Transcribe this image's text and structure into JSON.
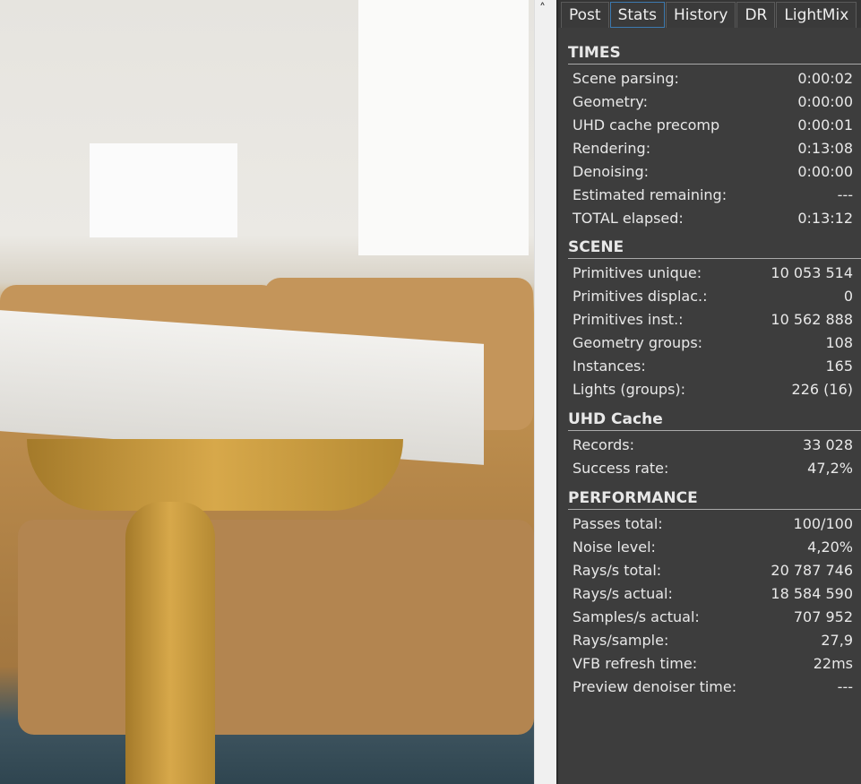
{
  "tabs": [
    "Post",
    "Stats",
    "History",
    "DR",
    "LightMix"
  ],
  "active_tab": "Stats",
  "sections": [
    {
      "title": "TIMES",
      "rows": [
        [
          "Scene parsing:",
          "0:00:02"
        ],
        [
          "Geometry:",
          "0:00:00"
        ],
        [
          "UHD cache precomp",
          "0:00:01"
        ],
        [
          "Rendering:",
          "0:13:08"
        ],
        [
          "Denoising:",
          "0:00:00"
        ],
        [
          "Estimated remaining:",
          "---"
        ],
        [
          "TOTAL elapsed:",
          "0:13:12"
        ]
      ]
    },
    {
      "title": "SCENE",
      "rows": [
        [
          "Primitives unique:",
          "10 053 514"
        ],
        [
          "Primitives displac.:",
          "0"
        ],
        [
          "Primitives inst.:",
          "10 562 888"
        ],
        [
          "Geometry groups:",
          "108"
        ],
        [
          "Instances:",
          "165"
        ],
        [
          "Lights (groups):",
          "226 (16)"
        ]
      ]
    },
    {
      "title": "UHD Cache",
      "rows": [
        [
          "Records:",
          "33 028"
        ],
        [
          "Success rate:",
          "47,2%"
        ]
      ]
    },
    {
      "title": "PERFORMANCE",
      "rows": [
        [
          "Passes total:",
          "100/100"
        ],
        [
          "Noise level:",
          "4,20%"
        ],
        [
          "Rays/s total:",
          "20 787 746"
        ],
        [
          "Rays/s actual:",
          "18 584 590"
        ],
        [
          "Samples/s actual:",
          "707 952"
        ],
        [
          "Rays/sample:",
          "27,9"
        ],
        [
          "VFB refresh time:",
          "22ms"
        ],
        [
          "Preview denoiser time:",
          "---"
        ]
      ]
    }
  ],
  "annotation_color": "#e02020"
}
